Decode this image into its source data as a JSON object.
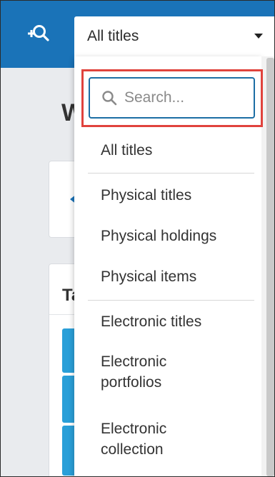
{
  "header": {
    "advanced_search_icon": "magnifier-plus-icon",
    "scope_select": {
      "selected_value": "All titles"
    }
  },
  "dropdown": {
    "search": {
      "placeholder": "Search...",
      "value": "",
      "icon": "search-icon"
    },
    "groups": [
      {
        "options": [
          "All titles"
        ]
      },
      {
        "options": [
          "Physical titles",
          "Physical holdings",
          "Physical items"
        ]
      },
      {
        "options": [
          "Electronic titles",
          "Electronic portfolios",
          "Electronic collection"
        ]
      }
    ]
  },
  "background": {
    "heading_fragment": "W",
    "card_title_fragment": "Ta"
  },
  "colors": {
    "header": "#1a73b8",
    "highlight_border": "#e0433d",
    "search_border": "#1c6ea4",
    "tile": "#2a9fd8"
  }
}
